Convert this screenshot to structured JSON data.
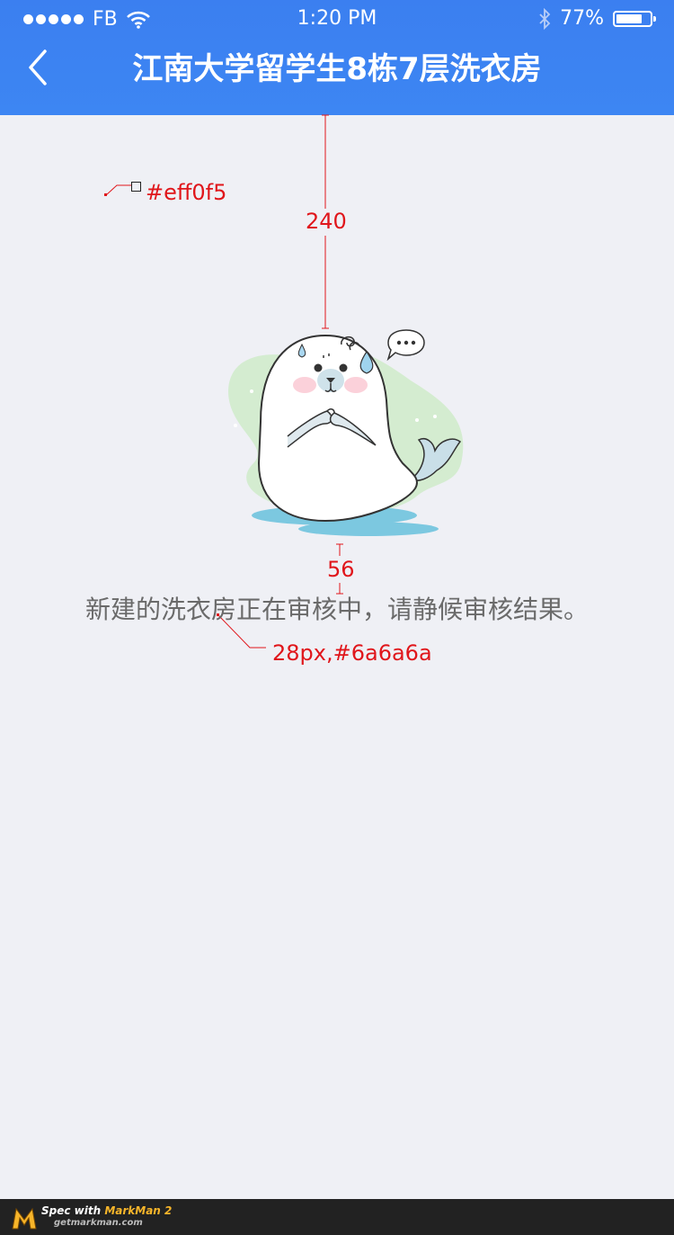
{
  "status_bar": {
    "carrier": "FB",
    "time": "1:20 PM",
    "battery_percent": "77%",
    "battery_level": 0.77,
    "icons": [
      "signal-dots-icon",
      "wifi-icon",
      "bluetooth-icon",
      "battery-icon"
    ]
  },
  "nav": {
    "back_icon": "chevron-left-icon",
    "title": "江南大学留学生8栋7层洗衣房"
  },
  "illustration": "seal-illustration",
  "message": "新建的洗衣房正在审核中，请静候审核结果。",
  "annotations": {
    "bg_color": "#eff0f5",
    "spacing_top": "240",
    "spacing_gap": "56",
    "text_spec": "28px,#6a6a6a"
  },
  "footer": {
    "spec_prefix": "Spec with ",
    "spec_brand": "MarkMan 2",
    "site": "getmarkman.com"
  },
  "colors": {
    "header": "#3d86f3",
    "background": "#eff0f5",
    "text": "#6a6a6a",
    "annotation": "#e0161b"
  }
}
